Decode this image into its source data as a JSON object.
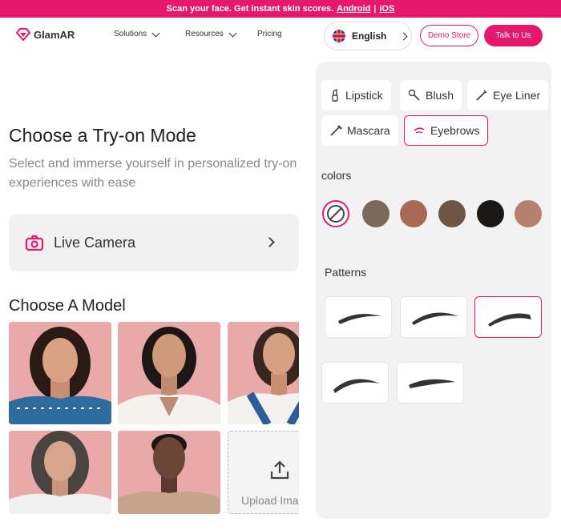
{
  "banner": {
    "text": "Scan your face. Get instant skin scores.",
    "android": "Android",
    "separator": "|",
    "ios": "iOS"
  },
  "nav": {
    "brand": "GlamAR",
    "solutions": "Solutions",
    "resources": "Resources",
    "pricing": "Pricing",
    "language": "English",
    "demo_store": "Demo Store",
    "talk_to_us": "Talk to Us"
  },
  "left": {
    "title": "Choose a Try-on Mode",
    "subtitle": "Select and immerse yourself in personalized try-on experiences with ease",
    "live_camera": "Live Camera",
    "model_title": "Choose A Model",
    "upload_label": "Upload Image"
  },
  "right": {
    "categories": [
      "Lipstick",
      "Blush",
      "Eye Liner",
      "Mascara",
      "Eyebrows"
    ],
    "active_category": "Eyebrows",
    "colors_label": "colors",
    "patterns_label": "Patterns",
    "swatches": [
      "#7a6a5e",
      "#a86a57",
      "#6e5546",
      "#1b1715",
      "#b5806c"
    ]
  },
  "colors": {
    "brand": "#e6186e"
  }
}
